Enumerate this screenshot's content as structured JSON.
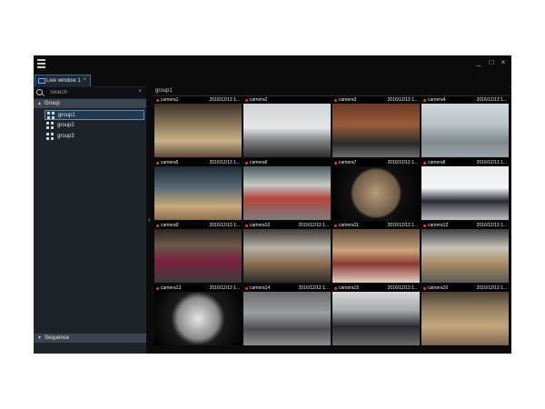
{
  "window": {
    "controls": [
      "_",
      "□",
      "×"
    ]
  },
  "tabs": [
    {
      "label": "Live window 1",
      "close": "×"
    }
  ],
  "sidebar": {
    "search": {
      "placeholder": "Search",
      "value": "",
      "clear": "×"
    },
    "group_section": {
      "label": "Group",
      "arrow": "▲"
    },
    "groups": [
      {
        "label": "group1",
        "selected": true
      },
      {
        "label": "group2",
        "selected": false
      },
      {
        "label": "group3",
        "selected": false
      }
    ],
    "sequence_section": {
      "label": "Sequence",
      "arrow": "▼"
    },
    "collapse_glyph": "‹"
  },
  "main": {
    "header": "group1",
    "cameras": [
      {
        "name": "camera1",
        "timestamp": "2016/12/13 1..."
      },
      {
        "name": "camera2",
        "timestamp": ""
      },
      {
        "name": "camera3",
        "timestamp": "2016/12/13 1..."
      },
      {
        "name": "camera4",
        "timestamp": "2016/12/13 1..."
      },
      {
        "name": "camera5",
        "timestamp": "2016/12/13 1..."
      },
      {
        "name": "camera6",
        "timestamp": ""
      },
      {
        "name": "camera7",
        "timestamp": "2016/12/13 1..."
      },
      {
        "name": "camera8",
        "timestamp": "2016/12/13 1..."
      },
      {
        "name": "camera9",
        "timestamp": "2016/12/13 1..."
      },
      {
        "name": "camera10",
        "timestamp": "2016/12/13 1..."
      },
      {
        "name": "camera11",
        "timestamp": "2016/12/13 1..."
      },
      {
        "name": "camera12",
        "timestamp": "2016/12/13 1..."
      },
      {
        "name": "camera13",
        "timestamp": "2016/12/13 1..."
      },
      {
        "name": "camera14",
        "timestamp": "2016/12/13 1..."
      },
      {
        "name": "camera15",
        "timestamp": "2016/12/13 1..."
      },
      {
        "name": "camera16",
        "timestamp": "2016/12/13 1..."
      }
    ]
  },
  "colors": {
    "window_bg": "#0b0b0c",
    "sidebar_bg": "#1d2329",
    "section_header": "#3a444e",
    "selection": "#22384c",
    "recording_dot": "#e23b3b",
    "tab_accent": "#3d6b98"
  }
}
